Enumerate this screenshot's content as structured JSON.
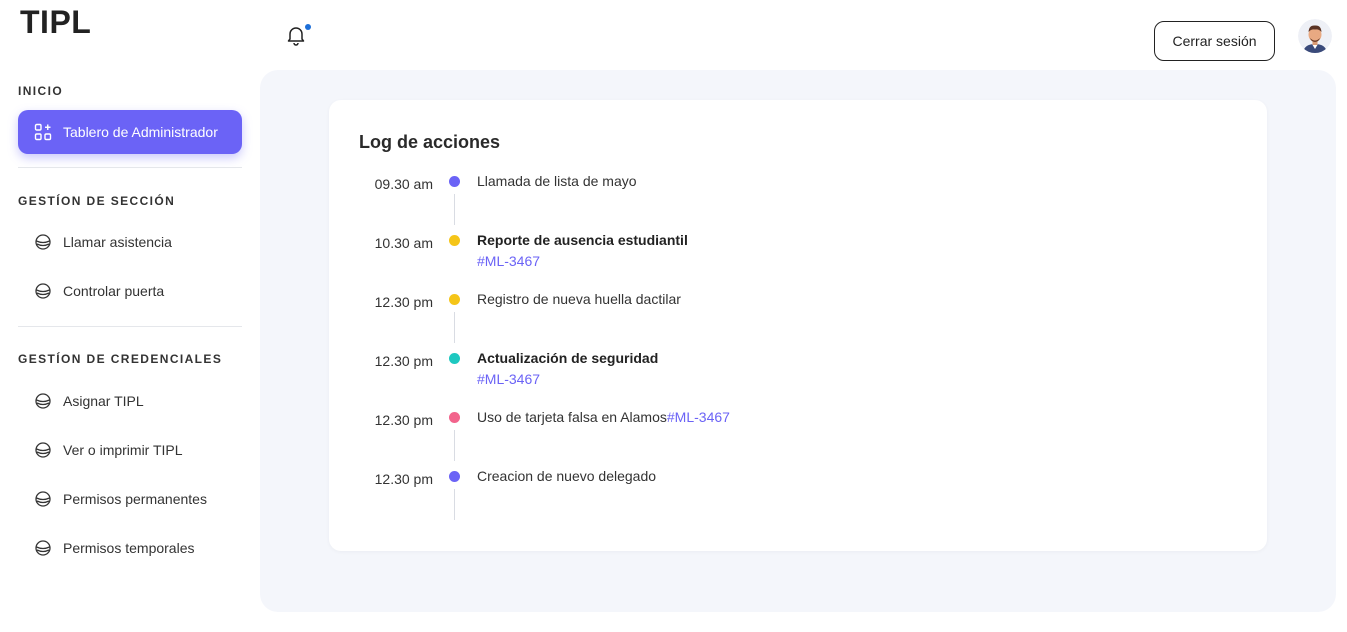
{
  "app": {
    "logo": "TIPL"
  },
  "sidebar": {
    "sections": [
      {
        "title": "INICIO"
      },
      {
        "title": "GESTÍON DE SECCIÓN"
      },
      {
        "title": "GESTÍON DE CREDENCIALES"
      }
    ],
    "items": [
      {
        "label": "Tablero de Administrador",
        "icon": "dashboard-icon"
      },
      {
        "label": "Llamar asistencia",
        "icon": "circle-icon"
      },
      {
        "label": "Controlar puerta",
        "icon": "circle-icon"
      },
      {
        "label": "Asignar TIPL",
        "icon": "circle-icon"
      },
      {
        "label": "Ver o imprimir TIPL",
        "icon": "circle-icon"
      },
      {
        "label": "Permisos permanentes",
        "icon": "circle-icon"
      },
      {
        "label": "Permisos temporales",
        "icon": "circle-icon"
      }
    ]
  },
  "topbar": {
    "logout_label": "Cerrar sesión",
    "bell_icon": "bell-icon",
    "notification_dot_color": "#1d6fd8"
  },
  "log": {
    "title": "Log de acciones",
    "entries": [
      {
        "time": "09.30 am",
        "text": "Llamada de lista de mayo",
        "tag": "",
        "color": "#6b63f6"
      },
      {
        "time": "10.30 am",
        "text": "Reporte de ausencia estudiantil",
        "tag": "#ML-3467",
        "color": "#f5c518"
      },
      {
        "time": "12.30 pm",
        "text": "Registro de nueva huella dactilar",
        "tag": "",
        "color": "#f5c518"
      },
      {
        "time": "12.30 pm",
        "text": "Actualización de seguridad",
        "tag": "#ML-3467",
        "color": "#1ec8c0"
      },
      {
        "time": "12.30 pm",
        "text": "Uso de tarjeta falsa en Alamos",
        "tag": "#ML-3467",
        "color": "#f2648c"
      },
      {
        "time": "12.30 pm",
        "text": "Creacion de nuevo delegado",
        "tag": "",
        "color": "#6b63f6"
      }
    ]
  },
  "colors": {
    "accent": "#6b63f6",
    "panel_bg": "#f4f6fb"
  }
}
